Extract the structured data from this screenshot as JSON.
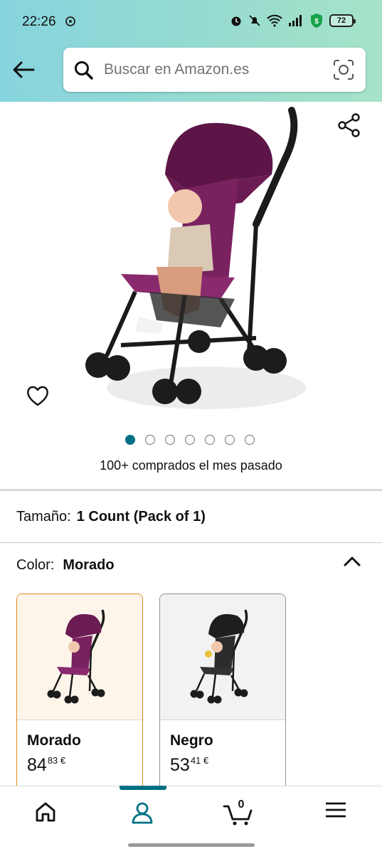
{
  "status_bar": {
    "time": "22:26",
    "battery": "72",
    "icons": [
      "leaf-icon",
      "alarm-icon",
      "mute-icon",
      "wifi-icon",
      "signal-icon",
      "shield-icon",
      "battery-icon"
    ]
  },
  "header": {
    "search_placeholder": "Buscar en Amazon.es",
    "icons": [
      "back-arrow-icon",
      "search-icon",
      "camera-scan-icon"
    ]
  },
  "gallery": {
    "image_count": 7,
    "active_index": 0,
    "icons": [
      "share-icon",
      "heart-icon"
    ]
  },
  "bought_text": "100+ comprados el mes pasado",
  "size": {
    "label": "Tamaño:",
    "value": "1 Count (Pack of 1)"
  },
  "color": {
    "label": "Color:",
    "value": "Morado"
  },
  "swatches": [
    {
      "name": "Morado",
      "price_whole": "84",
      "price_fraction": "83",
      "currency": "€",
      "selected": true,
      "accent": "#7a1d5a"
    },
    {
      "name": "Negro",
      "price_whole": "53",
      "price_fraction": "41",
      "currency": "€",
      "selected": false,
      "accent": "#1e1e1e"
    }
  ],
  "bottom_nav": {
    "cart_count": "0",
    "active": "profile",
    "items": [
      "home-icon",
      "profile-icon",
      "cart-icon",
      "menu-icon"
    ]
  },
  "colors": {
    "accent": "#007185",
    "selected_border": "#e08b1a",
    "header_start": "#86d4de",
    "header_end": "#a6e3c8"
  }
}
